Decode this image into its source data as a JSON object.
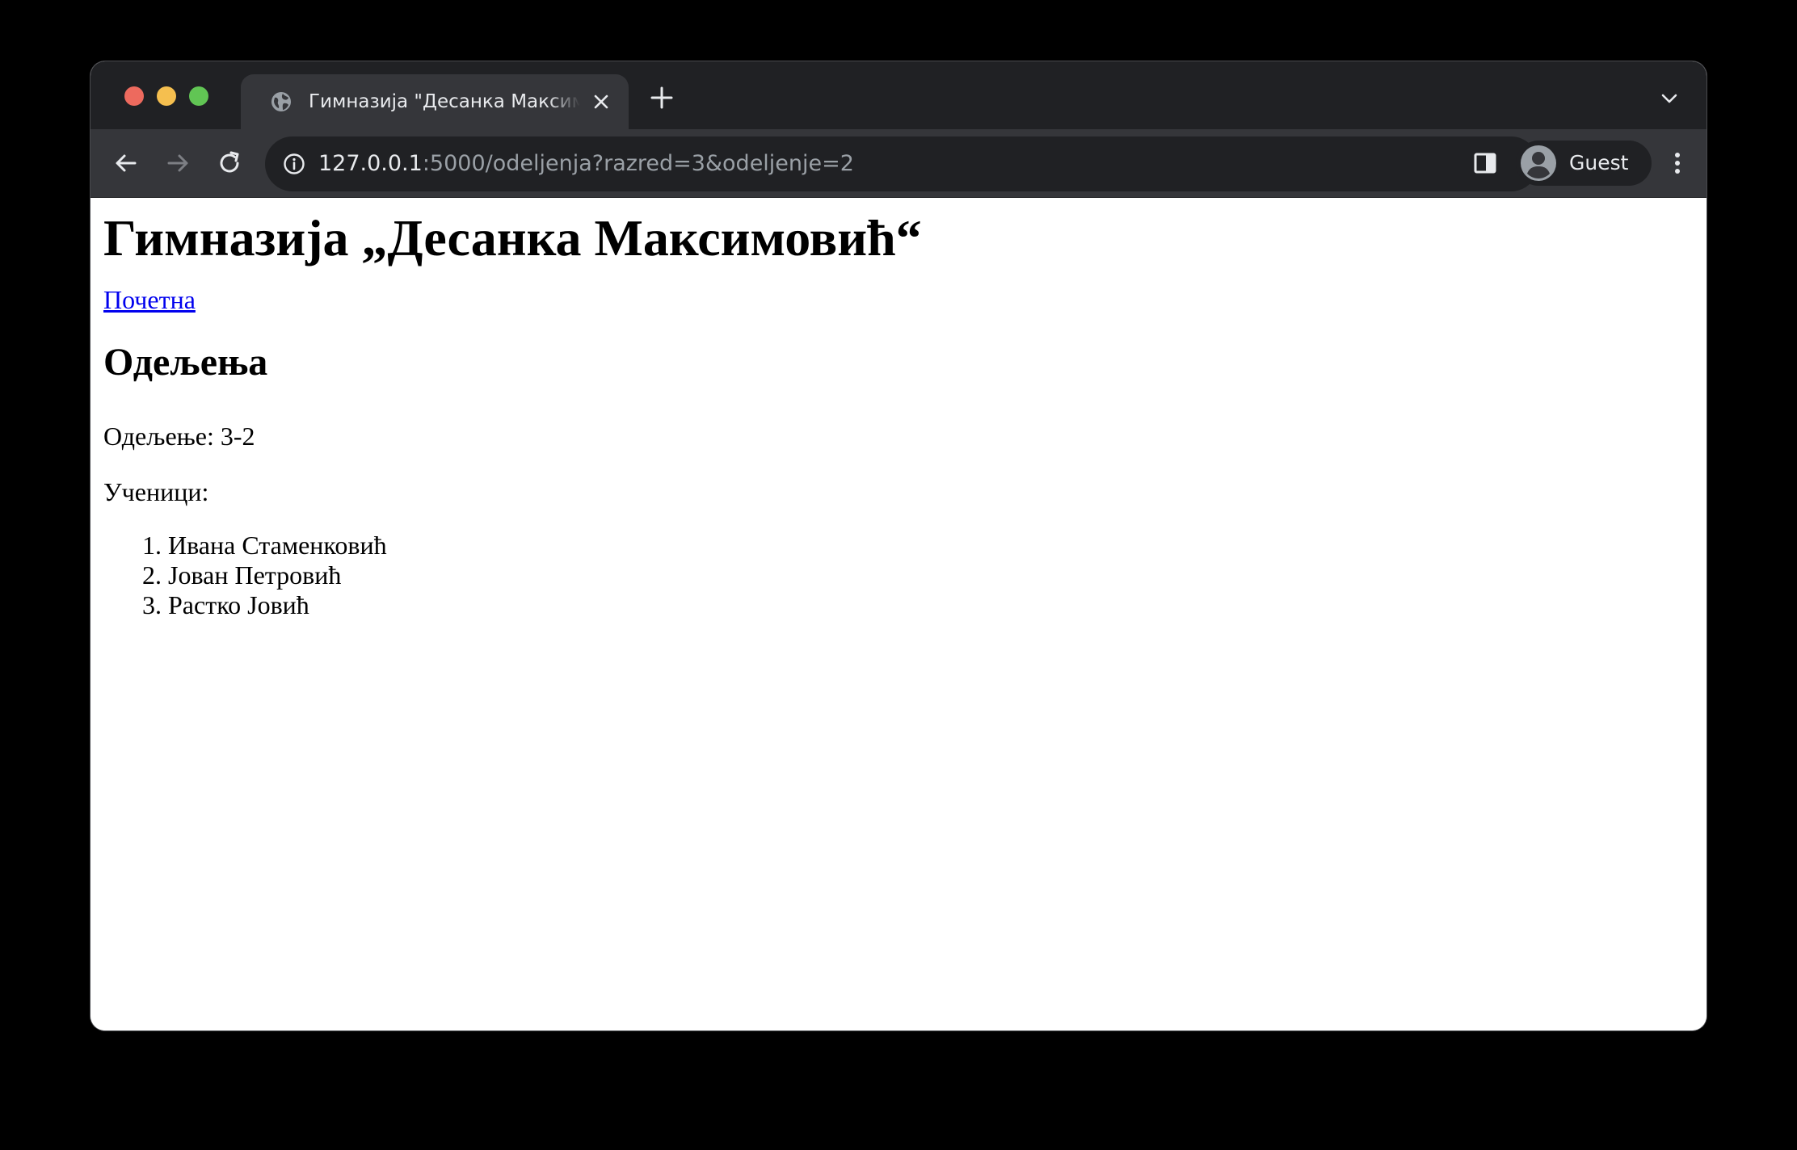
{
  "browser": {
    "tab_title": "Гимназија \"Десанка Максимовић\"",
    "url_host": "127.0.0.1",
    "url_rest": ":5000/odeljenja?razred=3&odeljenje=2",
    "profile_name": "Guest"
  },
  "page": {
    "heading": "Гимназија „Десанка Максимовић“",
    "home_link": "Почетна",
    "section_title": "Одељења",
    "class_line": "Одељење: 3-2",
    "students_label": "Ученици:",
    "students": [
      "Ивана Стаменковић",
      "Јован Петровић",
      "Растко Јовић"
    ]
  }
}
